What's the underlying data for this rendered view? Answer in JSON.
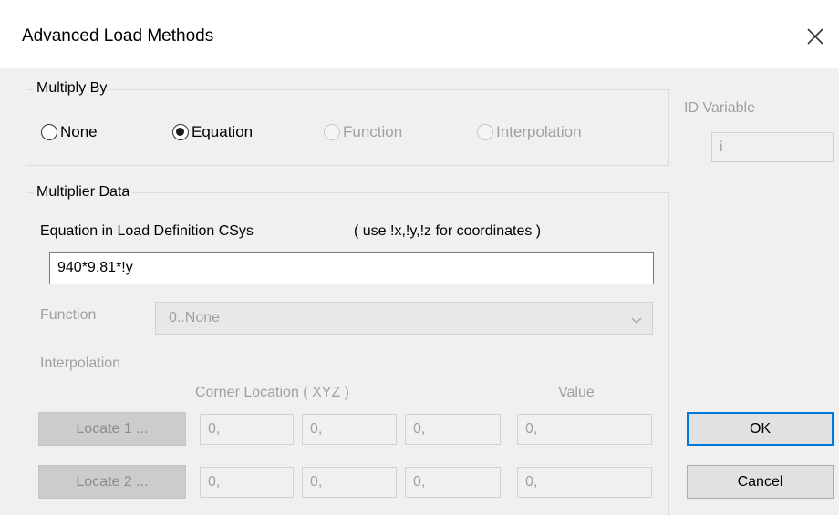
{
  "window": {
    "title": "Advanced Load Methods",
    "close_icon": "close-icon"
  },
  "multiply_by": {
    "label": "Multiply By",
    "options": [
      {
        "label": "None",
        "selected": false,
        "enabled": true
      },
      {
        "label": "Equation",
        "selected": true,
        "enabled": true
      },
      {
        "label": "Function",
        "selected": false,
        "enabled": false
      },
      {
        "label": "Interpolation",
        "selected": false,
        "enabled": false
      }
    ]
  },
  "id_variable": {
    "label": "ID Variable",
    "value": "i"
  },
  "multiplier_data": {
    "label": "Multiplier Data",
    "equation_label": "Equation in Load Definition CSys",
    "equation_hint": "( use !x,!y,!z for coordinates )",
    "equation_value": "940*9.81*!y",
    "function_label": "Function",
    "function_value": "0..None",
    "interpolation_label": "Interpolation",
    "corner_header": "Corner Location ( XYZ )",
    "value_header": "Value",
    "rows": [
      {
        "button": "Locate 1 ...",
        "x": "0,",
        "y": "0,",
        "z": "0,",
        "value": "0,"
      },
      {
        "button": "Locate 2 ...",
        "x": "0,",
        "y": "0,",
        "z": "0,",
        "value": "0,"
      }
    ]
  },
  "buttons": {
    "ok": "OK",
    "cancel": "Cancel"
  }
}
